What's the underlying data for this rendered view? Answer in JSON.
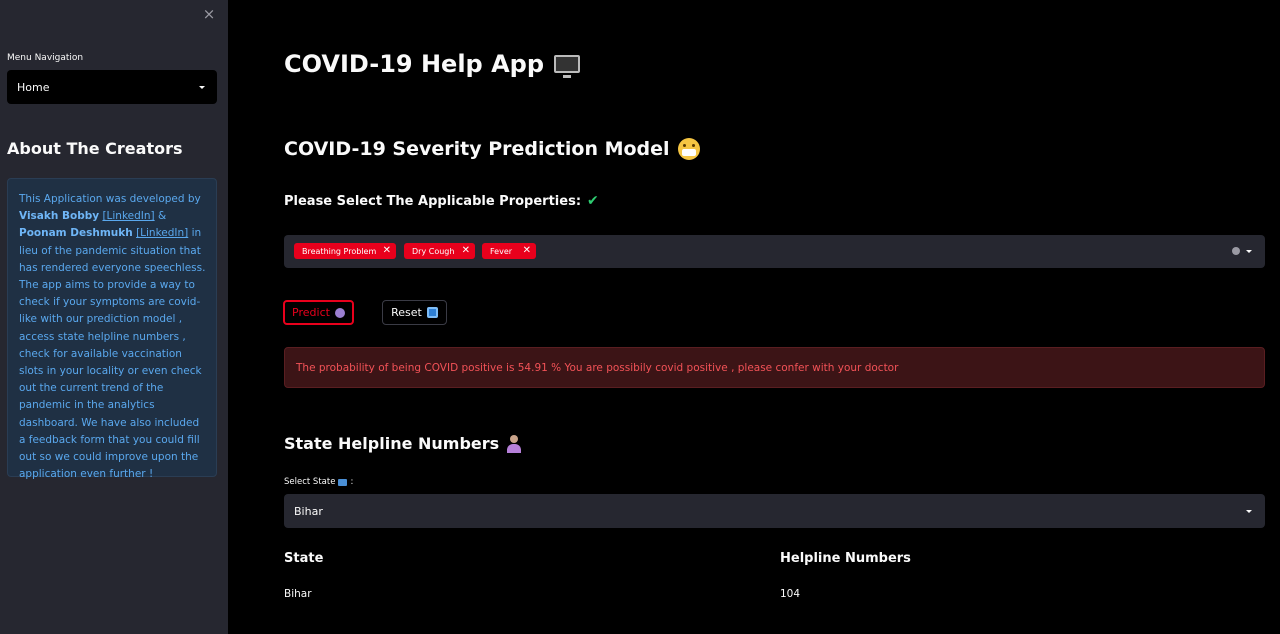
{
  "sidebar": {
    "close_icon": "×",
    "nav_label": "Menu Navigation",
    "nav_selected": "Home",
    "creators_title": "About The Creators",
    "about": {
      "intro": "This Application was developed by",
      "author1": "Visakh Bobby",
      "link1": "[LinkedIn]",
      "and": "&",
      "author2": "Poonam Deshmukh",
      "link2": "[LinkedIn]",
      "body": "in lieu of the pandemic situation that has rendered everyone speechless. The app aims to provide a way to check if your symptoms are covid-like with our prediction model , access state helpline numbers , check for available vaccination slots in your locality or even check out the current trend of the pandemic in the analytics dashboard. We have also included a feedback form that you could fill out so we could improve upon the application even further !"
    }
  },
  "main": {
    "app_title": "COVID-19 Help App",
    "severity_title": "COVID-19 Severity Prediction Model",
    "select_props_label": "Please Select The Applicable Properties:",
    "check_icon": "✔",
    "tags": [
      {
        "label": "Breathing Problem",
        "remove": "✕"
      },
      {
        "label": "Dry Cough",
        "remove": "✕"
      },
      {
        "label": "Fever",
        "remove": "✕"
      }
    ],
    "predict_label": "Predict",
    "reset_label": "Reset",
    "result_text": "The probability of being COVID positive is 54.91 % You are possibily covid positive , please confer with your doctor",
    "helpline_title": "State Helpline Numbers",
    "state_label": "Select State",
    "state_label_suffix": ":",
    "state_selected": "Bihar",
    "table": {
      "headers": [
        "State",
        "Helpline Numbers"
      ],
      "rows": [
        [
          "Bihar",
          "104"
        ]
      ]
    }
  },
  "colors": {
    "accent_red": "#e8001c",
    "sidebar_bg": "#262730",
    "info_bg": "#1f3044",
    "info_text": "#5aa8ee",
    "error_bg": "#3c1416",
    "error_text": "#f25257"
  },
  "icons": [
    "close-icon",
    "monitor-icon",
    "face-emoji-icon",
    "checkmark-icon",
    "crystal-ball-icon",
    "reset-icon",
    "person-icon",
    "map-icon",
    "clear-icon",
    "chevron-down-icon"
  ]
}
